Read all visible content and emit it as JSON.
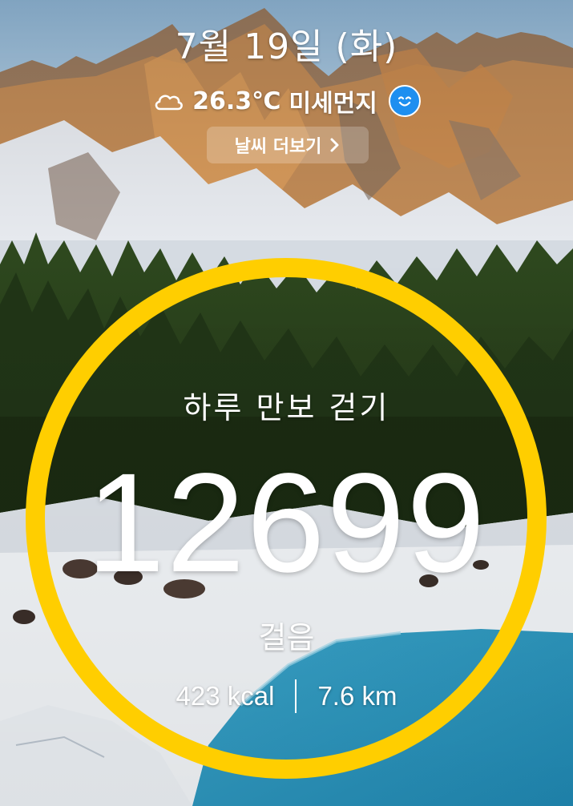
{
  "header": {
    "date": "7월 19일 (화)",
    "temperature": "26.3℃",
    "dust_label": "미세먼지",
    "dust_icon": "smile-face-icon",
    "weather_icon": "cloud-icon",
    "more_weather_label": "날씨 더보기"
  },
  "steps": {
    "title": "하루 만보 걷기",
    "count": "12699",
    "unit": "걸음",
    "calories": "423 kcal",
    "distance": "7.6 km",
    "ring_color": "#ffce00"
  },
  "colors": {
    "accent": "#ffce00",
    "dust_good": "#1e8ff0"
  }
}
